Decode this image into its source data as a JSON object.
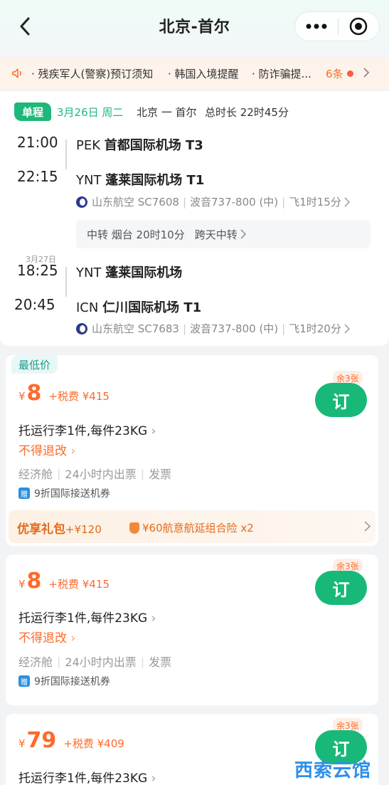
{
  "header": {
    "title": "北京-首尔",
    "back_icon": "chevron-left-icon",
    "more_icon": "more-dots-icon",
    "target_icon": "record-icon"
  },
  "notice": {
    "items": [
      "残疾军人(警察)预订须知",
      "韩国入境提醒",
      "防诈骗提..."
    ],
    "count": "6条"
  },
  "flight": {
    "tag": "单程",
    "date": "3月26日 周二",
    "route": "北京 一 首尔",
    "duration": "总时长 22时45分",
    "seg1": {
      "dep_time": "21:00",
      "dep_code": "PEK",
      "dep_airport": "首都国际机场 T3",
      "arr_time": "22:15",
      "arr_code": "YNT",
      "arr_airport": "蓬莱国际机场 T1",
      "airline": "山东航空 SC7608",
      "aircraft": "波音737-800 (中)",
      "flight_time": "飞1时15分"
    },
    "transfer": {
      "text": "中转 烟台 20时10分",
      "note": "跨天中转"
    },
    "seg2": {
      "next_day": "3月27日",
      "dep_time": "18:25",
      "dep_code": "YNT",
      "dep_airport": "蓬莱国际机场",
      "arr_time": "20:45",
      "arr_code": "ICN",
      "arr_airport": "仁川国际机场 T1",
      "airline": "山东航空 SC7683",
      "aircraft": "波音737-800 (中)",
      "flight_time": "飞1时20分"
    }
  },
  "offers": [
    {
      "lowest_tag": "最低价",
      "currency": "¥",
      "price": "8",
      "tax": "+税费 ¥415",
      "remaining": "余3张",
      "book_label": "订",
      "baggage": "托运行李1件,每件23KG",
      "refund": "不得退改",
      "cabin": "经济舱",
      "issue": "24小时内出票",
      "invoice": "发票",
      "coupon": "9折国际接送机券",
      "gift_title": "优享礼包",
      "gift_price": "+¥120",
      "gift_insurance": "¥60航意航延组合险 x2"
    },
    {
      "currency": "¥",
      "price": "8",
      "tax": "+税费 ¥415",
      "remaining": "余3张",
      "book_label": "订",
      "baggage": "托运行李1件,每件23KG",
      "refund": "不得退改",
      "cabin": "经济舱",
      "issue": "24小时内出票",
      "invoice": "发票",
      "coupon": "9折国际接送机券"
    },
    {
      "currency": "¥",
      "price": "79",
      "tax": "+税费 ¥409",
      "remaining": "余3张",
      "book_label": "订",
      "baggage": "托运行李1件,每件23KG"
    }
  ],
  "watermark": "西索云馆",
  "colors": {
    "brand_green": "#18b978",
    "price_orange": "#ff6a2a"
  }
}
